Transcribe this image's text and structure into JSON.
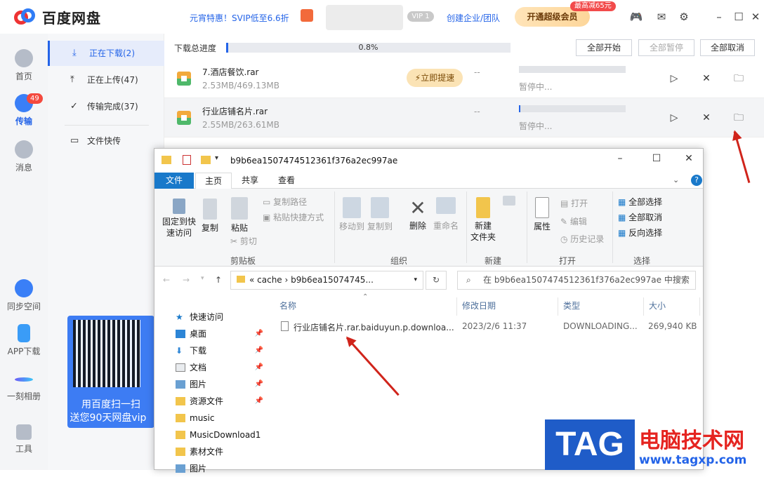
{
  "app": {
    "name": "百度网盘"
  },
  "top": {
    "promo": "元宵特惠！SVIP低至6.6折",
    "vip_badge": "VIP 1",
    "corp": "创建企业/团队",
    "super_btn": "开通超级会员",
    "super_tag": "最高减65元"
  },
  "leftnav": {
    "items": [
      {
        "label": "首页",
        "icon": "cloud-icon"
      },
      {
        "label": "传输",
        "icon": "transfer-icon",
        "badge": "49"
      },
      {
        "label": "消息",
        "icon": "user-icon"
      },
      {
        "label": "同步空间",
        "icon": "sync-icon"
      },
      {
        "label": "APP下载",
        "icon": "phone-icon"
      },
      {
        "label": "一刻相册",
        "icon": "album-icon"
      },
      {
        "label": "工具",
        "icon": "tools-icon"
      }
    ]
  },
  "sidebar": {
    "items": [
      {
        "label": "正在下载(2)"
      },
      {
        "label": "正在上传(47)"
      },
      {
        "label": "传输完成(37)"
      },
      {
        "label": "文件快传"
      }
    ],
    "qr": {
      "line1": "用百度扫一扫",
      "line2": "送您90天网盘vip"
    }
  },
  "downloads": {
    "progress_label": "下载总进度",
    "progress_pct": "0.8%",
    "progress_value": 0.008,
    "buttons": {
      "start_all": "全部开始",
      "pause_all": "全部暂停",
      "cancel_all": "全部取消"
    },
    "rows": [
      {
        "name": "7.酒店餐饮.rar",
        "size": "2.53MB/469.13MB",
        "speed": "--",
        "status": "暂停中...",
        "boost": "⚡立即提速"
      },
      {
        "name": "行业店铺名片.rar",
        "size": "2.55MB/263.61MB",
        "speed": "--",
        "status": "暂停中..."
      }
    ]
  },
  "explorer": {
    "title": "b9b6ea1507474512361f376a2ec997ae",
    "tabs": [
      "文件",
      "主页",
      "共享",
      "查看"
    ],
    "ribbon": {
      "pin": "固定到快\n速访问",
      "copy": "复制",
      "paste": "粘贴",
      "copy_path": "复制路径",
      "paste_shortcut": "粘贴快捷方式",
      "cut": "剪切",
      "move_to": "移动到",
      "copy_to": "复制到",
      "delete": "删除",
      "rename": "重命名",
      "new_folder": "新建\n文件夹",
      "properties": "属性",
      "open": "打开",
      "edit": "编辑",
      "history": "历史记录",
      "select_all": "全部选择",
      "select_none": "全部取消",
      "invert": "反向选择",
      "groups": [
        "剪贴板",
        "组织",
        "新建",
        "打开",
        "选择"
      ]
    },
    "address": "«  cache  ›  b9b6ea15074745...",
    "search": "在 b9b6ea1507474512361f376a2ec997ae 中搜索",
    "nav": [
      "快速访问",
      "桌面",
      "下载",
      "文档",
      "图片",
      "资源文件",
      "music",
      "MusicDownload1",
      "素材文件",
      "图片"
    ],
    "columns": [
      "名称",
      "修改日期",
      "类型",
      "大小"
    ],
    "file": {
      "name": "行业店铺名片.rar.baiduyun.p.downloa...",
      "date": "2023/2/6 11:37",
      "type": "DOWNLOADING...",
      "size": "269,940 KB"
    }
  },
  "watermark": {
    "tag": "TAG",
    "cn": "电脑技术网",
    "url": "www.tagxp.com"
  }
}
